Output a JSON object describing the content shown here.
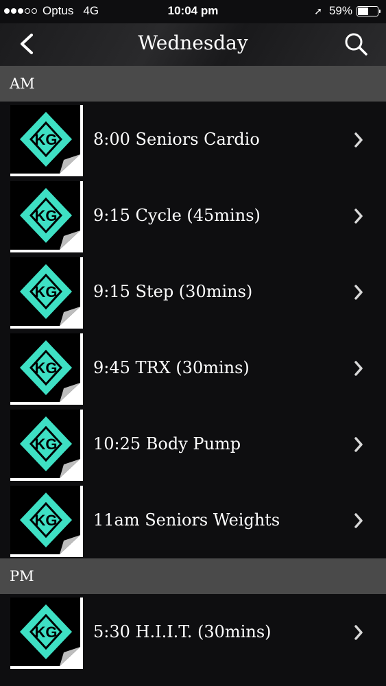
{
  "status_bar": {
    "carrier": "Optus",
    "network": "4G",
    "time": "10:04 pm",
    "battery_percent": "59%",
    "battery_level": 0.59,
    "signal_bars": 3,
    "signal_total": 5
  },
  "nav": {
    "title": "Wednesday",
    "back_icon": "chevron-left-icon",
    "search_icon": "search-icon"
  },
  "logo_text": "KG",
  "sections": [
    {
      "label": "AM",
      "items": [
        {
          "label": "8:00 Seniors Cardio"
        },
        {
          "label": "9:15 Cycle (45mins)"
        },
        {
          "label": "9:15 Step (30mins)"
        },
        {
          "label": "9:45 TRX (30mins)"
        },
        {
          "label": "10:25 Body Pump"
        },
        {
          "label": "11am Seniors Weights"
        }
      ]
    },
    {
      "label": "PM",
      "items": [
        {
          "label": "5:30 H.I.I.T. (30mins)"
        }
      ]
    }
  ],
  "colors": {
    "background": "#0e0e10",
    "section_header": "#4a4a4a",
    "logo_teal": "#3ee0c4",
    "text": "#ffffff"
  }
}
